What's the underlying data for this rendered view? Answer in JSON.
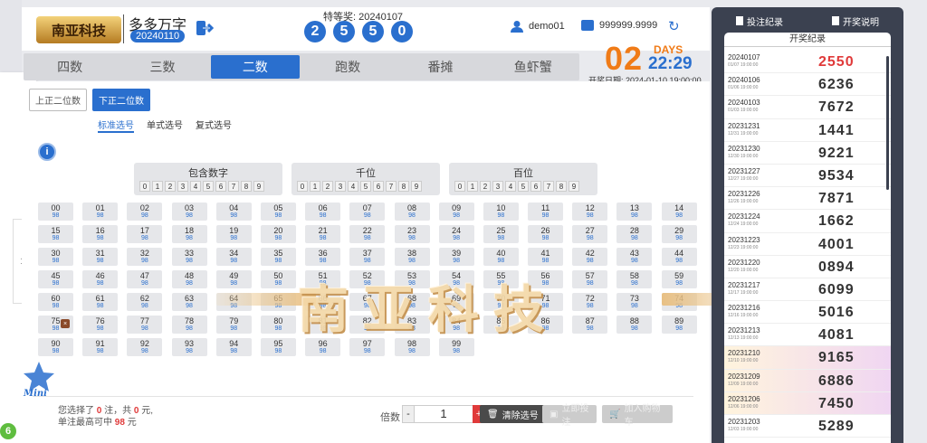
{
  "header": {
    "logo": "南亚科技",
    "game_name": "多多万字",
    "game_period": "20240110",
    "special_label": "特等奖: 20240107",
    "balls": [
      "2",
      "5",
      "5",
      "0"
    ],
    "user": "demo01",
    "balance": "999999.9999"
  },
  "tabs": [
    "四数",
    "三数",
    "二数",
    "跑数",
    "番摊",
    "鱼虾蟹"
  ],
  "active_tab": 2,
  "countdown": {
    "days": "02",
    "days_label": "DAYS",
    "time": "22:29",
    "draw_date": "开奖日期: 2024-01-10 19:00:00"
  },
  "subtabs": [
    "上正二位数",
    "下正二位数"
  ],
  "modes": [
    "标准选号",
    "单式选号",
    "复式选号"
  ],
  "groups": [
    {
      "title": "包含数字",
      "digits": [
        "0",
        "1",
        "2",
        "3",
        "4",
        "5",
        "6",
        "7",
        "8",
        "9"
      ]
    },
    {
      "title": "千位",
      "digits": [
        "0",
        "1",
        "2",
        "3",
        "4",
        "5",
        "6",
        "7",
        "8",
        "9"
      ]
    },
    {
      "title": "百位",
      "digits": [
        "0",
        "1",
        "2",
        "3",
        "4",
        "5",
        "6",
        "7",
        "8",
        "9"
      ]
    }
  ],
  "odds": "98",
  "numbers": [
    "00",
    "01",
    "02",
    "03",
    "04",
    "05",
    "06",
    "07",
    "08",
    "09",
    "10",
    "11",
    "12",
    "13",
    "14",
    "15",
    "16",
    "17",
    "18",
    "19",
    "20",
    "21",
    "22",
    "23",
    "24",
    "25",
    "26",
    "27",
    "28",
    "29",
    "30",
    "31",
    "32",
    "33",
    "34",
    "35",
    "36",
    "37",
    "38",
    "39",
    "40",
    "41",
    "42",
    "43",
    "44",
    "45",
    "46",
    "47",
    "48",
    "49",
    "50",
    "51",
    "52",
    "53",
    "54",
    "55",
    "56",
    "57",
    "58",
    "59",
    "60",
    "61",
    "62",
    "63",
    "64",
    "65",
    "66",
    "67",
    "68",
    "69",
    "70",
    "71",
    "72",
    "73",
    "74",
    "75",
    "76",
    "77",
    "78",
    "79",
    "80",
    "81",
    "82",
    "83",
    "84",
    "85",
    "86",
    "87",
    "88",
    "89",
    "90",
    "91",
    "92",
    "93",
    "94",
    "95",
    "96",
    "97",
    "98",
    "99"
  ],
  "watermark": "南亚科技",
  "footer": {
    "sel_line1_pre": "您选择了",
    "sel_count": "0",
    "sel_line1_mid": "注，共",
    "sel_amount": "0",
    "sel_line1_post": "元,",
    "sel_line2_pre": "单注最高可中",
    "max_win": "98",
    "sel_line2_post": "元",
    "multiplier_label": "倍数",
    "multiplier_value": "1",
    "minus": "-",
    "plus": "+",
    "clear": "清除选号",
    "bet": "立即投注",
    "cart": "加入购物车"
  },
  "corner_badge": "6",
  "right": {
    "bet_record": "投注纪录",
    "rules": "开奖说明",
    "history_title": "开奖纪录",
    "history": [
      {
        "period": "20240107",
        "time": "01/07 19:00:00",
        "result": "2550"
      },
      {
        "period": "20240106",
        "time": "01/06 19:00:00",
        "result": "6236"
      },
      {
        "period": "20240103",
        "time": "01/03 19:00:00",
        "result": "7672"
      },
      {
        "period": "20231231",
        "time": "12/31 19:00:00",
        "result": "1441"
      },
      {
        "period": "20231230",
        "time": "12/30 19:00:00",
        "result": "9221"
      },
      {
        "period": "20231227",
        "time": "12/27 19:00:00",
        "result": "9534"
      },
      {
        "period": "20231226",
        "time": "12/26 19:00:00",
        "result": "7871"
      },
      {
        "period": "20231224",
        "time": "12/24 19:00:00",
        "result": "1662"
      },
      {
        "period": "20231223",
        "time": "12/23 19:00:00",
        "result": "4001"
      },
      {
        "period": "20231220",
        "time": "12/20 19:00:00",
        "result": "0894"
      },
      {
        "period": "20231217",
        "time": "12/17 19:00:00",
        "result": "6099"
      },
      {
        "period": "20231216",
        "time": "12/16 19:00:00",
        "result": "5016"
      },
      {
        "period": "20231213",
        "time": "12/13 19:00:00",
        "result": "4081"
      },
      {
        "period": "20231210",
        "time": "12/10 19:00:00",
        "result": "9165"
      },
      {
        "period": "20231209",
        "time": "12/09 19:00:00",
        "result": "6886"
      },
      {
        "period": "20231206",
        "time": "12/06 19:00:00",
        "result": "7450"
      },
      {
        "period": "20231203",
        "time": "12/03 19:00:00",
        "result": "5289"
      }
    ]
  }
}
